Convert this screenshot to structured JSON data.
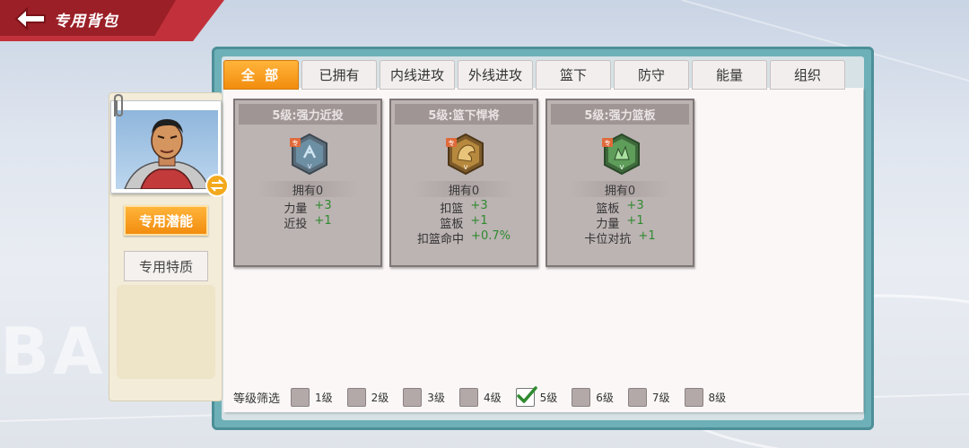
{
  "header": {
    "title": "专用背包"
  },
  "tabs": [
    {
      "label": "全 部",
      "active": true
    },
    {
      "label": "已拥有",
      "active": false
    },
    {
      "label": "内线进攻",
      "active": false
    },
    {
      "label": "外线进攻",
      "active": false
    },
    {
      "label": "篮下",
      "active": false
    },
    {
      "label": "防守",
      "active": false
    },
    {
      "label": "能量",
      "active": false
    },
    {
      "label": "组织",
      "active": false
    }
  ],
  "sidebar": {
    "buttons": [
      {
        "label": "专用潜能",
        "active": true
      },
      {
        "label": "专用特质",
        "active": false
      }
    ]
  },
  "cards": [
    {
      "title": "5级:强力近投",
      "icon": "strength-shot-badge-icon",
      "icon_color": "#6d8fa3",
      "badge": "专",
      "grade": "V",
      "owned": "拥有0",
      "stats": [
        {
          "name": "力量",
          "value": "+3"
        },
        {
          "name": "近投",
          "value": "+1"
        }
      ]
    },
    {
      "title": "5级:篮下悍将",
      "icon": "paint-warrior-badge-icon",
      "icon_color": "#b7893e",
      "badge": "专",
      "grade": "V",
      "owned": "拥有0",
      "stats": [
        {
          "name": "扣篮",
          "value": "+3"
        },
        {
          "name": "篮板",
          "value": "+1"
        },
        {
          "name": "扣篮命中",
          "value": "+0.7%"
        }
      ]
    },
    {
      "title": "5级:强力篮板",
      "icon": "strength-rebound-badge-icon",
      "icon_color": "#5f9d5a",
      "badge": "专",
      "grade": "V",
      "owned": "拥有0",
      "stats": [
        {
          "name": "篮板",
          "value": "+3"
        },
        {
          "name": "力量",
          "value": "+1"
        },
        {
          "name": "卡位对抗",
          "value": "+1"
        }
      ]
    }
  ],
  "filter": {
    "label": "等级筛选",
    "options": [
      {
        "label": "1级",
        "checked": false
      },
      {
        "label": "2级",
        "checked": false
      },
      {
        "label": "3级",
        "checked": false
      },
      {
        "label": "4级",
        "checked": false
      },
      {
        "label": "5级",
        "checked": true
      },
      {
        "label": "6级",
        "checked": false
      },
      {
        "label": "7级",
        "checked": false
      },
      {
        "label": "8级",
        "checked": false
      }
    ]
  },
  "background_text": "BAS",
  "colors": {
    "accent": "#f28d0f",
    "header_red": "#c2313b",
    "frame_teal": "#6eb0b7",
    "stat_green": "#2f8a2f"
  }
}
